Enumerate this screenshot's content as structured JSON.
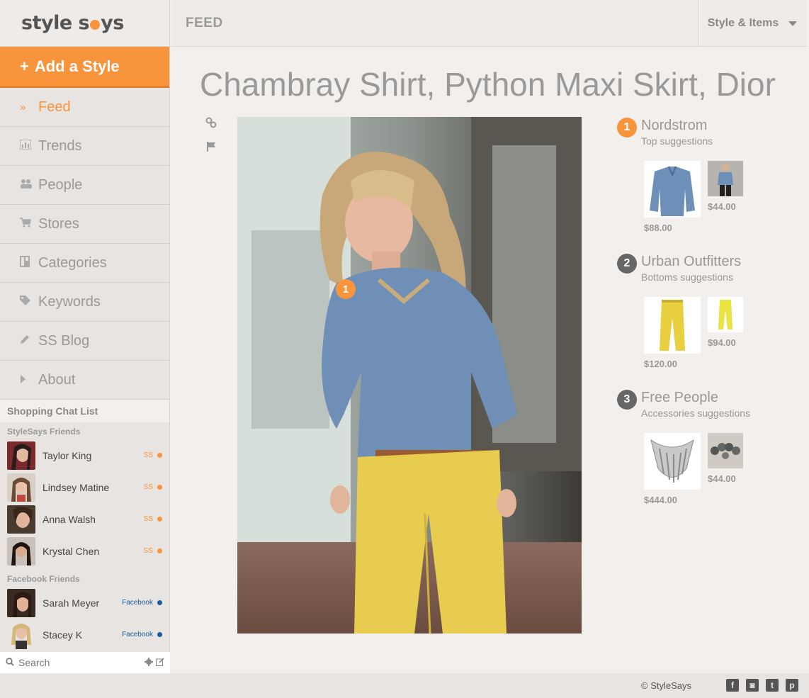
{
  "brand": {
    "logo_left": "style s",
    "logo_right": "ys"
  },
  "sidebar": {
    "add_style_label": "Add a Style",
    "items": [
      {
        "label": "Feed",
        "icon": "chevron-double-right-icon",
        "active": true
      },
      {
        "label": "Trends",
        "icon": "bar-chart-icon"
      },
      {
        "label": "People",
        "icon": "people-icon"
      },
      {
        "label": "Stores",
        "icon": "cart-icon"
      },
      {
        "label": "Categories",
        "icon": "grid-icon"
      },
      {
        "label": "Keywords",
        "icon": "tags-icon"
      },
      {
        "label": "SS Blog",
        "icon": "pencil-icon"
      },
      {
        "label": "About",
        "icon": "caret-right-icon"
      }
    ]
  },
  "chat": {
    "title": "Shopping Chat List",
    "stylesays_group": "StyleSays Friends",
    "facebook_group": "Facebook Friends",
    "stylesays_friends": [
      {
        "name": "Taylor King",
        "tag": "SS"
      },
      {
        "name": "Lindsey Matine",
        "tag": "SS"
      },
      {
        "name": "Anna Walsh",
        "tag": "SS"
      },
      {
        "name": "Krystal Chen",
        "tag": "SS"
      }
    ],
    "facebook_friends": [
      {
        "name": "Sarah Meyer",
        "tag": "Facebook"
      },
      {
        "name": "Stacey K",
        "tag": "Facebook"
      }
    ],
    "search_placeholder": "Search"
  },
  "header": {
    "title": "FEED",
    "dropdown_label": "Style & Items"
  },
  "post": {
    "title": "Chambray Shirt, Python Maxi Skirt, Dior",
    "pin_number": "1"
  },
  "suggestions": [
    {
      "number": "1",
      "store": "Nordstrom",
      "subtitle": "Top suggestions",
      "price_large": "$88.00",
      "price_small": "$44.00",
      "badge_color": "#f7943c"
    },
    {
      "number": "2",
      "store": "Urban Outfitters",
      "subtitle": "Bottoms suggestions",
      "price_large": "$120.00",
      "price_small": "$94.00",
      "badge_color": "#666666"
    },
    {
      "number": "3",
      "store": "Free People",
      "subtitle": "Accessories suggestions",
      "price_large": "$444.00",
      "price_small": "$44.00",
      "badge_color": "#666666"
    }
  ],
  "footer": {
    "copyright": "© StyleSays",
    "social": [
      "f",
      "◙",
      "t",
      "p"
    ]
  },
  "colors": {
    "accent": "#f7943c",
    "facebook": "#1a5c9c"
  }
}
